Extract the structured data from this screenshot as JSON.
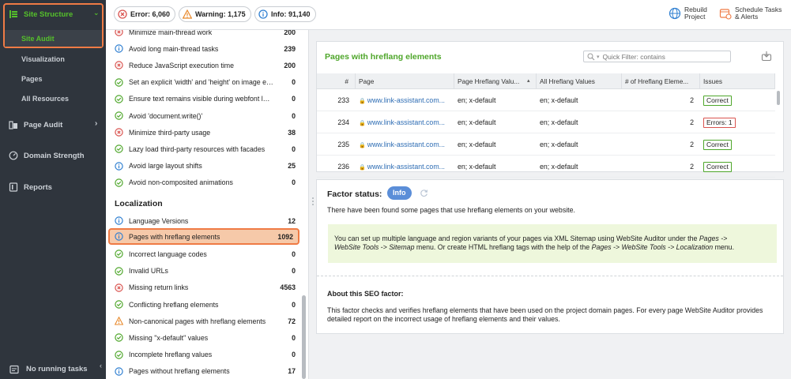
{
  "sidebar": {
    "site_structure": "Site Structure",
    "site_audit": "Site Audit",
    "visualization": "Visualization",
    "pages": "Pages",
    "all_resources": "All Resources",
    "page_audit": "Page Audit",
    "domain_strength": "Domain Strength",
    "reports": "Reports",
    "no_running_tasks": "No running tasks"
  },
  "topbar": {
    "error": "Error: 6,060",
    "warning": "Warning: 1,175",
    "info": "Info: 91,140",
    "rebuild_line1": "Rebuild",
    "rebuild_line2": "Project",
    "schedule_line1": "Schedule Tasks",
    "schedule_line2": "& Alerts"
  },
  "factors_top": [
    {
      "label": "Minimize main-thread work",
      "count": "200",
      "status": "error"
    },
    {
      "label": "Avoid long main-thread tasks",
      "count": "239",
      "status": "info"
    },
    {
      "label": "Reduce JavaScript execution time",
      "count": "200",
      "status": "error"
    },
    {
      "label": "Set an explicit 'width' and 'height' on image ele...",
      "count": "0",
      "status": "ok"
    },
    {
      "label": "Ensure text remains visible during webfont load",
      "count": "0",
      "status": "ok"
    },
    {
      "label": "Avoid 'document.write()'",
      "count": "0",
      "status": "ok"
    },
    {
      "label": "Minimize third-party usage",
      "count": "38",
      "status": "error"
    },
    {
      "label": "Lazy load third-party resources with facades",
      "count": "0",
      "status": "ok"
    },
    {
      "label": "Avoid large layout shifts",
      "count": "25",
      "status": "info"
    },
    {
      "label": "Avoid non-composited animations",
      "count": "0",
      "status": "ok"
    }
  ],
  "localization_heading": "Localization",
  "factors_loc": [
    {
      "label": "Language Versions",
      "count": "12",
      "status": "info"
    },
    {
      "label": "Pages with hreflang elements",
      "count": "1092",
      "status": "info",
      "selected": true
    },
    {
      "label": "Incorrect language codes",
      "count": "0",
      "status": "ok"
    },
    {
      "label": "Invalid URLs",
      "count": "0",
      "status": "ok"
    },
    {
      "label": "Missing return links",
      "count": "4563",
      "status": "error"
    },
    {
      "label": "Conflicting hreflang elements",
      "count": "0",
      "status": "ok"
    },
    {
      "label": "Non-canonical pages with hreflang elements",
      "count": "72",
      "status": "warning"
    },
    {
      "label": "Missing \"x-default\" values",
      "count": "0",
      "status": "ok"
    },
    {
      "label": "Incomplete hreflang values",
      "count": "0",
      "status": "ok"
    },
    {
      "label": "Pages without hreflang elements",
      "count": "17",
      "status": "info"
    }
  ],
  "panel": {
    "title": "Pages with hreflang elements",
    "filter_placeholder": "Quick Filter: contains",
    "columns": [
      "#",
      "Page",
      "Page Hreflang Valu...",
      "All Hreflang Values",
      "# of Hreflang Eleme...",
      "Issues"
    ],
    "rows": [
      {
        "num": "233",
        "page": "www.link-assistant.com...",
        "page_hreflang": "en; x-default",
        "all_hreflang": "en; x-default",
        "count": "2",
        "issue": "Correct",
        "issue_type": "ok"
      },
      {
        "num": "234",
        "page": "www.link-assistant.com...",
        "page_hreflang": "en; x-default",
        "all_hreflang": "en; x-default",
        "count": "2",
        "issue": "Errors: 1",
        "issue_type": "error"
      },
      {
        "num": "235",
        "page": "www.link-assistant.com...",
        "page_hreflang": "en; x-default",
        "all_hreflang": "en; x-default",
        "count": "2",
        "issue": "Correct",
        "issue_type": "ok"
      },
      {
        "num": "236",
        "page": "www.link-assistant.com...",
        "page_hreflang": "en; x-default",
        "all_hreflang": "en; x-default",
        "count": "2",
        "issue": "Correct",
        "issue_type": "ok"
      }
    ]
  },
  "factor_status": {
    "title": "Factor status:",
    "badge": "Info",
    "description": "There have been found some pages that use hreflang elements on your website.",
    "tip_1": "You can set up multiple language and region variants of your pages via XML Sitemap using WebSite Auditor under the ",
    "tip_2": "Pages ->",
    "tip_3": "WebSite Tools -> Sitemap",
    "tip_4": " menu. Or create HTML hreflang tags with the help of the ",
    "tip_5": "Pages -> WebSite Tools -> Localization",
    "tip_6": " menu.",
    "about_title": "About this SEO factor:",
    "about_text": "This factor checks and verifies hreflang elements that have been used on the project domain pages. For every page WebSite Auditor provides detailed report on the incorrect usage of hreflang elements and their values."
  },
  "colors": {
    "accent_green": "#55c02b",
    "highlight": "#ef7b45",
    "error": "#d9534f",
    "warning": "#e8892b",
    "info": "#2f7fd1"
  }
}
